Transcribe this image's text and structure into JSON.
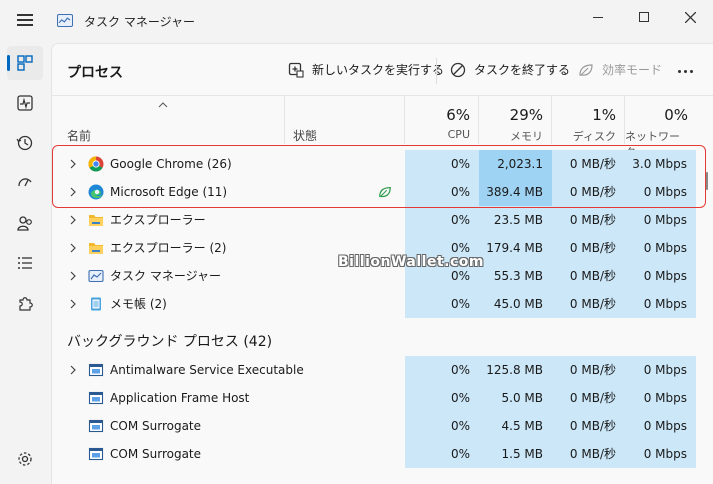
{
  "window": {
    "title": "タスク マネージャー"
  },
  "page": {
    "title": "プロセス"
  },
  "toolbar": {
    "new_task": "新しいタスクを実行する",
    "end_task": "タスクを終了する",
    "efficiency": "効率モード"
  },
  "columns": {
    "name": "名前",
    "status": "状態",
    "cpu_pct": "6%",
    "cpu": "CPU",
    "mem_pct": "29%",
    "mem": "メモリ",
    "disk_pct": "1%",
    "disk": "ディスク",
    "net_pct": "0%",
    "net": "ネットワーク"
  },
  "apps": [
    {
      "name": "Google Chrome (26)",
      "cpu": "0%",
      "mem": "2,023.1 MB",
      "disk": "0 MB/秒",
      "net": "3.0 Mbps",
      "icon": "chrome-icon"
    },
    {
      "name": "Microsoft Edge (11)",
      "cpu": "0%",
      "mem": "389.4 MB",
      "disk": "0 MB/秒",
      "net": "0 Mbps",
      "icon": "edge-icon",
      "status": "efficiency-leaf-icon"
    },
    {
      "name": "エクスプローラー",
      "cpu": "0%",
      "mem": "23.5 MB",
      "disk": "0 MB/秒",
      "net": "0 Mbps",
      "icon": "folder-icon"
    },
    {
      "name": "エクスプローラー (2)",
      "cpu": "0%",
      "mem": "179.4 MB",
      "disk": "0 MB/秒",
      "net": "0 Mbps",
      "icon": "folder-icon"
    },
    {
      "name": "タスク マネージャー",
      "cpu": "0%",
      "mem": "55.3 MB",
      "disk": "0 MB/秒",
      "net": "0 Mbps",
      "icon": "task-manager-icon"
    },
    {
      "name": "メモ帳 (2)",
      "cpu": "0%",
      "mem": "45.0 MB",
      "disk": "0 MB/秒",
      "net": "0 Mbps",
      "icon": "notepad-icon"
    }
  ],
  "background": {
    "title": "バックグラウンド プロセス (42)",
    "rows": [
      {
        "name": "Antimalware Service Executable",
        "cpu": "0%",
        "mem": "125.8 MB",
        "disk": "0 MB/秒",
        "net": "0 Mbps",
        "expandable": true
      },
      {
        "name": "Application Frame Host",
        "cpu": "0%",
        "mem": "5.0 MB",
        "disk": "0 MB/秒",
        "net": "0 Mbps",
        "expandable": false
      },
      {
        "name": "COM Surrogate",
        "cpu": "0%",
        "mem": "4.5 MB",
        "disk": "0 MB/秒",
        "net": "0 Mbps",
        "expandable": false
      },
      {
        "name": "COM Surrogate",
        "cpu": "0%",
        "mem": "1.5 MB",
        "disk": "0 MB/秒",
        "net": "0 Mbps",
        "expandable": false
      }
    ]
  },
  "watermark": "BillionWallet.com",
  "colors": {
    "accent": "#0067c0",
    "heat_light": "#cbe7f8",
    "heat_mid": "#9fd3f3",
    "highlight": "#e53935"
  }
}
